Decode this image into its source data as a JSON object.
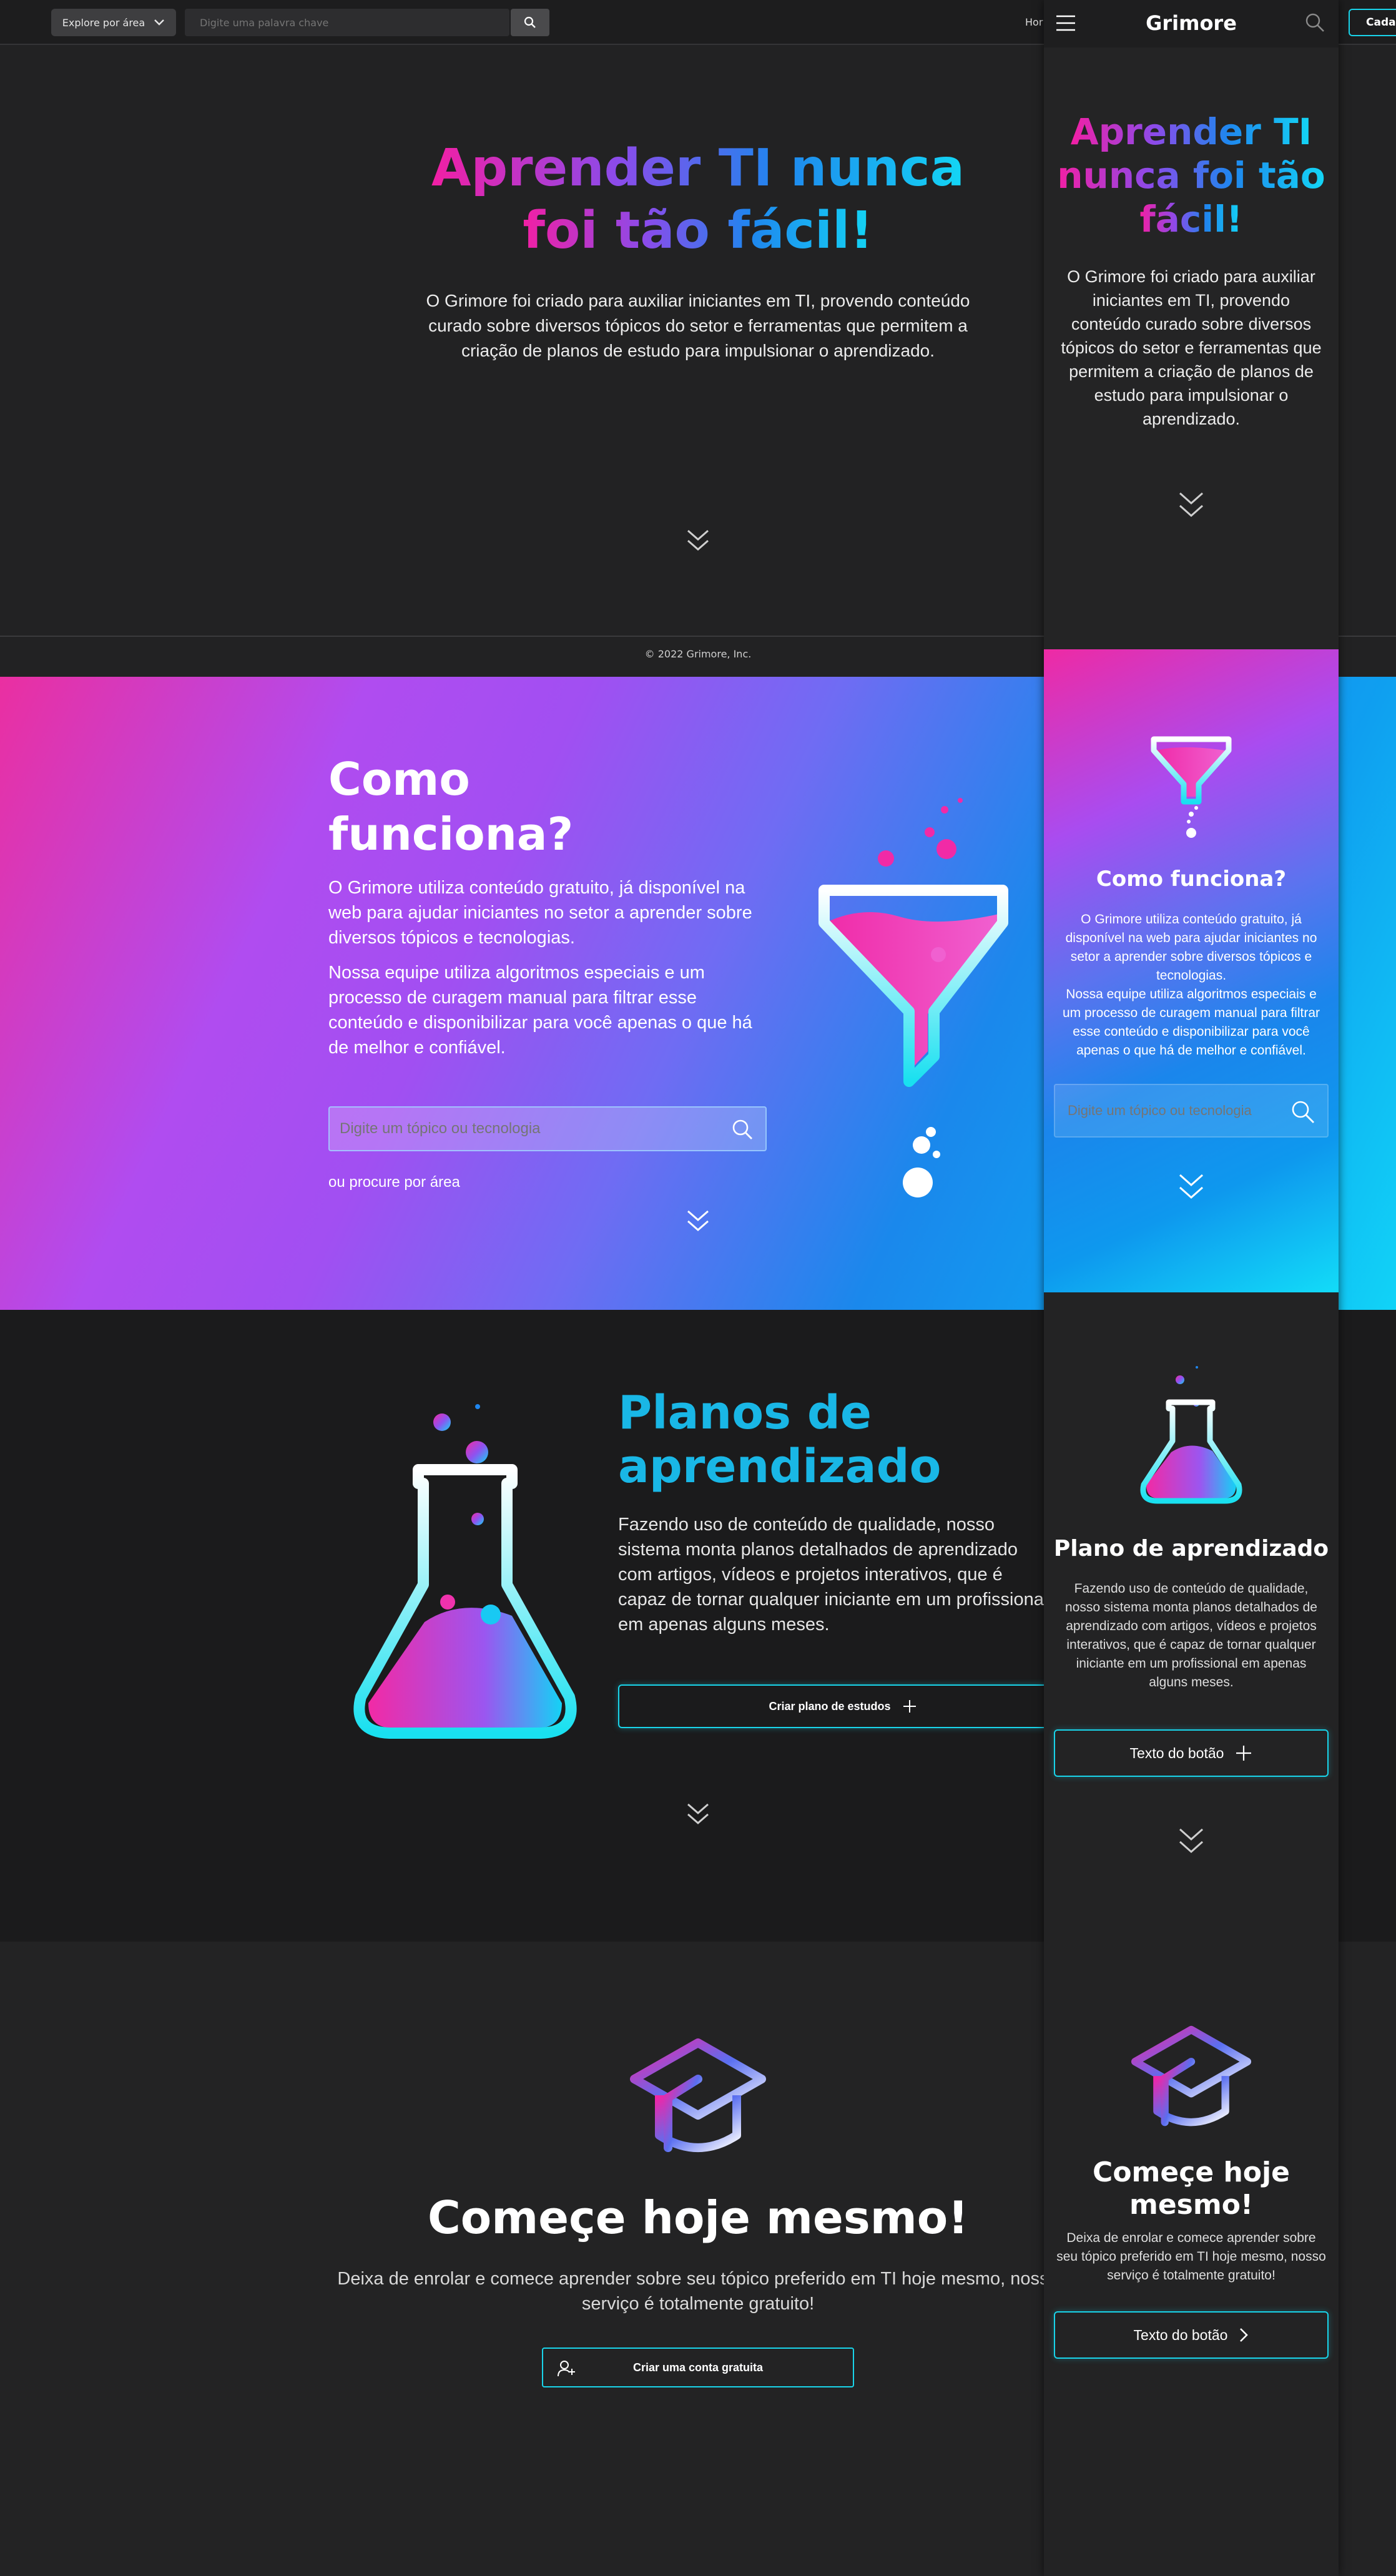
{
  "desktop": {
    "topbar": {
      "explore_label": "Explore por área",
      "search_placeholder": "Digite uma palavra chave",
      "home_label": "Hor",
      "signup_label": "Cada"
    },
    "hero": {
      "title_line1": "Aprender TI nunca",
      "title_line2": "foi tão fácil!",
      "subtitle": "O Grimore foi criado para auxiliar  iniciantes em TI, provendo conteúdo curado sobre diversos tópicos do setor e ferramentas que permitem a criação de planos de estudo para impulsionar o aprendizado."
    },
    "footer": {
      "copyright": "© 2022 Grimore, Inc."
    },
    "how": {
      "title": "Como funciona?",
      "p1": "O Grimore utiliza conteúdo gratuito, já disponível na web para ajudar iniciantes no setor a aprender sobre diversos tópicos e tecnologias.",
      "p2": "Nossa equipe utiliza algoritmos especiais e um processo de curagem manual para filtrar esse conteúdo e disponibilizar para você apenas o que há de melhor e confiável.",
      "search_placeholder": "Digite um tópico ou tecnologia",
      "area_link": "ou procure por área"
    },
    "plans": {
      "title": "Planos de aprendizado",
      "text": "Fazendo uso de conteúdo de qualidade, nosso sistema monta planos detalhados de aprendizado com artigos, vídeos e projetos interativos, que é capaz de tornar qualquer iniciante em um profissional em apenas alguns meses.",
      "button": "Criar plano de estudos"
    },
    "start": {
      "title": "Começe hoje mesmo!",
      "text": "Deixa de enrolar e comece aprender sobre seu tópico preferido em TI hoje mesmo, nosso serviço é totalmente gratuito!",
      "button": "Criar uma conta gratuita"
    }
  },
  "mobile": {
    "header": {
      "title": "Grimore"
    },
    "hero": {
      "title_line1": "Aprender TI",
      "title_line2": "nunca foi tão",
      "title_line3": "fácil!",
      "subtitle": "O Grimore foi criado para auxiliar iniciantes em TI, provendo conteúdo curado sobre diversos tópicos do setor e ferramentas que permitem a criação de planos de estudo para impulsionar o aprendizado."
    },
    "how": {
      "title": "Como funciona?",
      "p1": "O Grimore utiliza conteúdo gratuito, já disponível na web para ajudar iniciantes no setor a aprender sobre diversos tópicos e tecnologias.",
      "p2": "Nossa equipe utiliza algoritmos especiais e um processo de curagem manual para filtrar esse conteúdo e disponibilizar para você apenas o que há  de melhor e confiável.",
      "search_placeholder": "Digite um tópico ou tecnologia"
    },
    "plans": {
      "title": "Plano de aprendizado",
      "text": "Fazendo uso de conteúdo de qualidade, nosso sistema monta planos detalhados de aprendizado com artigos, vídeos e projetos interativos, que é capaz de tornar qualquer iniciante em um profissional em apenas alguns meses.",
      "button": "Texto do botão"
    },
    "start": {
      "title": "Começe hoje mesmo!",
      "text": "Deixa de enrolar e comece aprender sobre seu tópico preferido em TI hoje mesmo, nosso serviço é totalmente gratuito!",
      "button": "Texto do botão"
    }
  },
  "colors": {
    "accent_cyan": "#19d4ea",
    "brand_pink": "#f21fa4",
    "brand_blue": "#1f86ee",
    "plans_title": "#19b7e6",
    "background": "#222223"
  },
  "icons": [
    "chevron-down-icon",
    "search-icon",
    "menu-icon",
    "plus-icon",
    "add-user-icon",
    "chevron-right-icon",
    "double-chevron-down-icon",
    "funnel-icon",
    "flask-icon",
    "graduation-cap-icon"
  ]
}
